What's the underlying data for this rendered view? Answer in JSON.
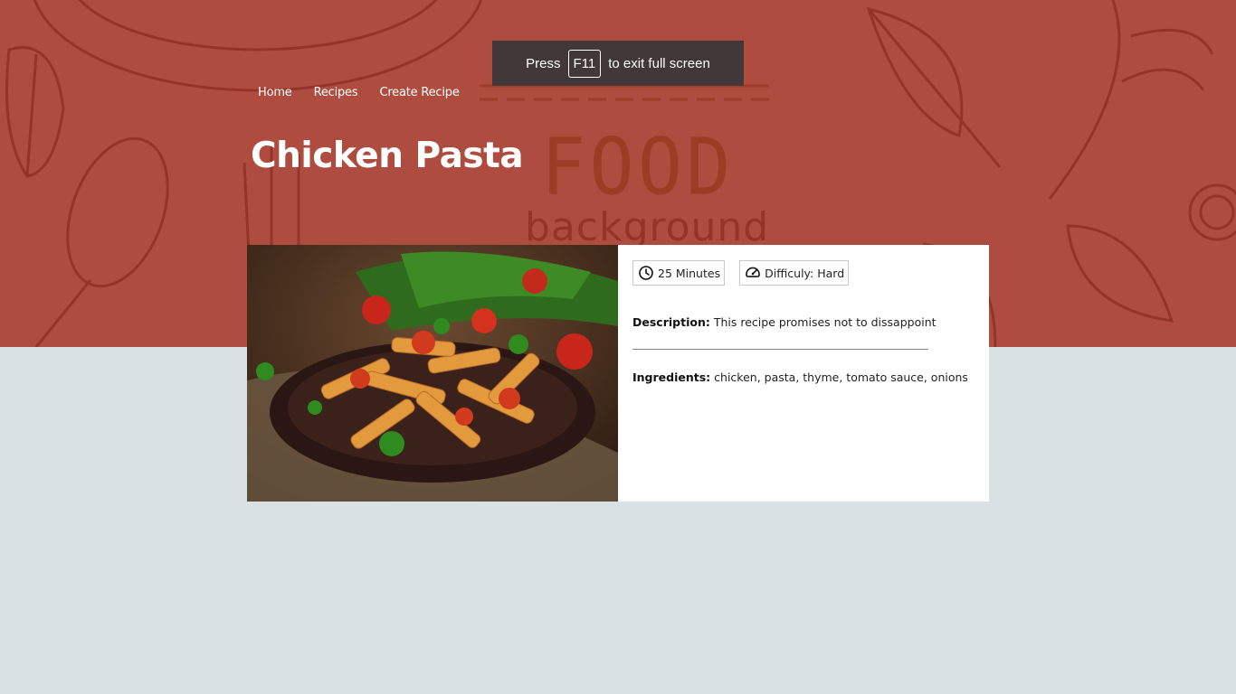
{
  "page": {
    "title": "Chicken Pasta",
    "hero_text_top": "FOOD",
    "hero_text_bottom": "background"
  },
  "nav": {
    "items": [
      "Home",
      "Recipes",
      "Create Recipe"
    ]
  },
  "fullscreen_toast": {
    "prefix": "Press",
    "key": "F11",
    "suffix": "to exit full screen"
  },
  "recipe": {
    "time": "25 Minutes",
    "difficulty": "Difficuly: Hard",
    "description_label": "Description:",
    "description": "This recipe promises not to dissappoint",
    "ingredients_label": "Ingredients:",
    "ingredients": "chicken, pasta, thyme, tomato sauce, onions",
    "time_icon": "clock-icon",
    "difficulty_icon": "speedometer-icon"
  },
  "colors": {
    "hero_bg": "#ae4c40",
    "page_bg": "#dae1e4",
    "card_bg": "#ffffff"
  }
}
